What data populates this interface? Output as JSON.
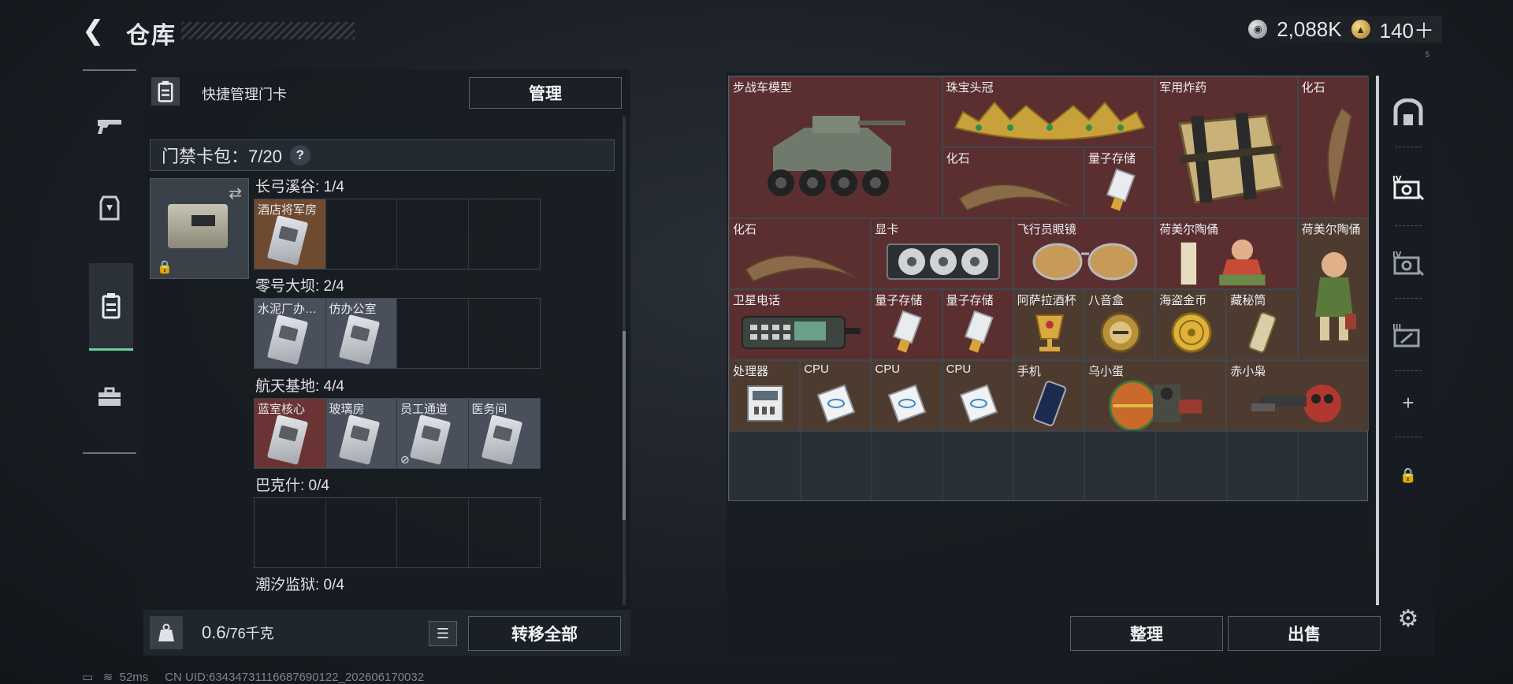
{
  "header": {
    "title": "仓库",
    "currency_silver": "2,088K",
    "currency_gold": "140＋",
    "version": "5"
  },
  "left_rail": {
    "items": [
      {
        "icon": "gun-icon"
      },
      {
        "icon": "armor-icon"
      },
      {
        "icon": "keycard-icon",
        "active": true
      },
      {
        "icon": "toolbox-icon"
      }
    ]
  },
  "left_panel": {
    "title": "快捷管理门卡",
    "manage_button": "管理",
    "card_bag_label": "门禁卡包：7/20",
    "help": "?",
    "maps": [
      {
        "title": "长弓溪谷: 1/4",
        "slots": [
          {
            "label": "酒店将军房",
            "color": "orange"
          },
          {},
          {},
          {}
        ]
      },
      {
        "title": "零号大坝: 2/4",
        "slots": [
          {
            "label": "水泥厂办…",
            "color": "gray"
          },
          {
            "label": "仿办公室",
            "color": "gray"
          },
          {},
          {}
        ]
      },
      {
        "title": "航天基地: 4/4",
        "slots": [
          {
            "label": "蓝室核心",
            "color": "red"
          },
          {
            "label": "玻璃房",
            "color": "gray"
          },
          {
            "label": "员工通道",
            "color": "gray",
            "badge": "⊘"
          },
          {
            "label": "医务间",
            "color": "gray"
          }
        ]
      },
      {
        "title": "巴克什: 0/4",
        "slots": [
          {},
          {},
          {},
          {}
        ]
      },
      {
        "title": "潮汐监狱: 0/4",
        "slots": [
          {},
          {},
          {},
          {}
        ]
      }
    ],
    "weight_value": "0.6",
    "weight_unit": "/76千克",
    "transfer_all": "转移全部"
  },
  "status_bar": {
    "ping": "52ms",
    "uid": "CN UID:63434731116687690122_202606170032"
  },
  "storage": {
    "items": [
      {
        "label": "步战车模型",
        "color": "red",
        "col": 0,
        "row": 0,
        "w": 3,
        "h": 2,
        "art": "ifv"
      },
      {
        "label": "珠宝头冠",
        "color": "red",
        "col": 3,
        "row": 0,
        "w": 3,
        "h": 1,
        "art": "crown"
      },
      {
        "label": "军用炸药",
        "color": "red",
        "col": 6,
        "row": 0,
        "w": 2,
        "h": 2,
        "art": "crate"
      },
      {
        "label": "化石",
        "color": "red",
        "col": 8,
        "row": 0,
        "w": 1,
        "h": 2,
        "art": "claw-v"
      },
      {
        "label": "化石",
        "color": "red",
        "col": 3,
        "row": 1,
        "w": 2,
        "h": 1,
        "art": "claw"
      },
      {
        "label": "量子存储",
        "color": "red",
        "col": 5,
        "row": 1,
        "w": 1,
        "h": 1,
        "art": "usb"
      },
      {
        "label": "化石",
        "color": "red",
        "col": 0,
        "row": 2,
        "w": 2,
        "h": 1,
        "art": "claw"
      },
      {
        "label": "显卡",
        "color": "red",
        "col": 2,
        "row": 2,
        "w": 2,
        "h": 1,
        "art": "gpu"
      },
      {
        "label": "飞行员眼镜",
        "color": "red",
        "col": 4,
        "row": 2,
        "w": 2,
        "h": 1,
        "art": "glasses"
      },
      {
        "label": "荷美尔陶俑",
        "color": "red",
        "col": 6,
        "row": 2,
        "w": 2,
        "h": 1,
        "art": "figure"
      },
      {
        "label": "荷美尔陶俑",
        "color": "brown",
        "col": 8,
        "row": 2,
        "w": 1,
        "h": 2,
        "art": "figure-v"
      },
      {
        "label": "卫星电话",
        "color": "red",
        "col": 0,
        "row": 3,
        "w": 2,
        "h": 1,
        "art": "phone-sat"
      },
      {
        "label": "量子存储",
        "color": "red",
        "col": 2,
        "row": 3,
        "w": 1,
        "h": 1,
        "art": "usb"
      },
      {
        "label": "量子存储",
        "color": "red",
        "col": 3,
        "row": 3,
        "w": 1,
        "h": 1,
        "art": "usb"
      },
      {
        "label": "阿萨拉酒杯",
        "color": "brown",
        "col": 4,
        "row": 3,
        "w": 1,
        "h": 1,
        "art": "cup"
      },
      {
        "label": "八音盒",
        "color": "brown",
        "col": 5,
        "row": 3,
        "w": 1,
        "h": 1,
        "art": "musicbox"
      },
      {
        "label": "海盗金币",
        "color": "brown",
        "col": 6,
        "row": 3,
        "w": 1,
        "h": 1,
        "art": "coin"
      },
      {
        "label": "藏秘筒",
        "color": "brown",
        "col": 7,
        "row": 3,
        "w": 1,
        "h": 1,
        "art": "tube"
      },
      {
        "label": "处理器",
        "color": "brown",
        "col": 0,
        "row": 4,
        "w": 1,
        "h": 1,
        "art": "processor"
      },
      {
        "label": "CPU",
        "color": "brown",
        "col": 1,
        "row": 4,
        "w": 1,
        "h": 1,
        "art": "cpu"
      },
      {
        "label": "CPU",
        "color": "brown",
        "col": 2,
        "row": 4,
        "w": 1,
        "h": 1,
        "art": "cpu"
      },
      {
        "label": "CPU",
        "color": "brown",
        "col": 3,
        "row": 4,
        "w": 1,
        "h": 1,
        "art": "cpu"
      },
      {
        "label": "手机",
        "color": "brown",
        "col": 4,
        "row": 4,
        "w": 1,
        "h": 1,
        "art": "phone"
      },
      {
        "label": "乌小蛋",
        "color": "brown",
        "col": 5,
        "row": 4,
        "w": 2,
        "h": 1,
        "art": "egg"
      },
      {
        "label": "赤小枭",
        "color": "brown",
        "col": 7,
        "row": 4,
        "w": 2,
        "h": 1,
        "art": "owl"
      }
    ],
    "sort_button": "整理",
    "sell_button": "出售"
  },
  "right_rail": {
    "items": [
      {
        "icon": "bunker-icon"
      },
      {
        "icon": "safe-iv-icon"
      },
      {
        "icon": "safe-iv-icon"
      },
      {
        "icon": "safe-iii-icon"
      },
      {
        "icon": "plus-icon"
      },
      {
        "icon": "lock-icon"
      },
      {
        "icon": "gear-icon"
      }
    ]
  }
}
